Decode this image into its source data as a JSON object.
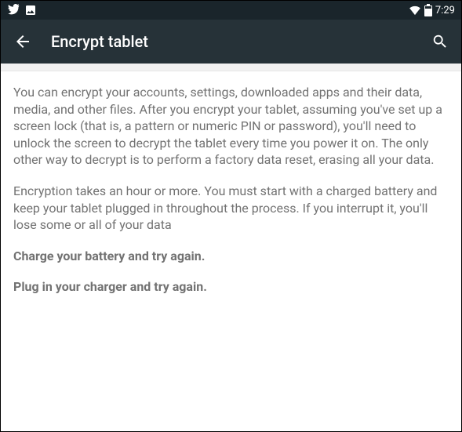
{
  "status": {
    "clock": "7:29"
  },
  "appbar": {
    "title": "Encrypt tablet"
  },
  "body": {
    "para1": "You can encrypt your accounts, settings, downloaded apps and their data, media, and other files. After you encrypt your tablet, assuming you've set up a screen lock (that is, a pattern or numeric PIN or password), you'll need to unlock the screen to decrypt the tablet every time you power it on. The only other way to decrypt is to perform a factory data reset, erasing all your data.",
    "para2": "Encryption takes an hour or more. You must start with a charged battery and keep your tablet plugged in throughout the process. If you interrupt it, you'll lose some or all of your data",
    "warn1": "Charge your battery and try again.",
    "warn2": "Plug in your charger and try again."
  }
}
